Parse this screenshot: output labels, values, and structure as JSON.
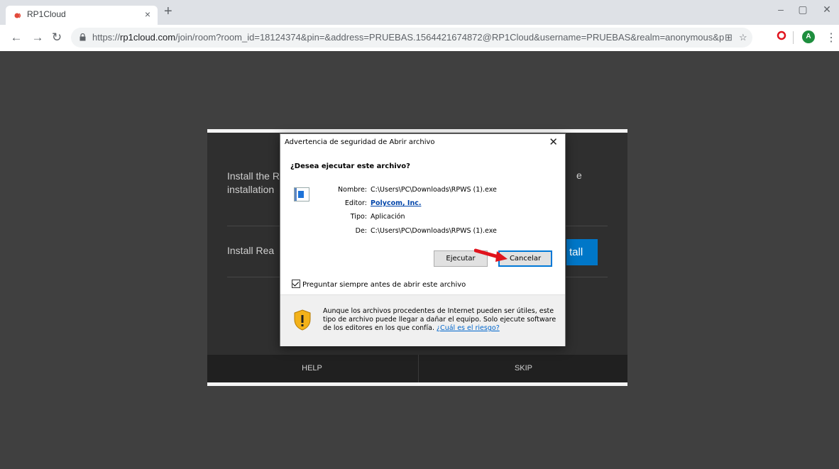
{
  "browser": {
    "tab_title": "RP1Cloud",
    "tab_close": "×",
    "new_tab": "+",
    "url_prefix": "https://",
    "url_host": "rp1cloud.com",
    "url_rest": "/join/room?room_id=18124374&pin=&address=PRUEBAS.1564421674872@RP1Cloud&username=PRUEBAS&realm=anonymous&path=mea&...",
    "profile_initial": "A",
    "window_controls": [
      "–",
      "▢",
      "✕"
    ]
  },
  "page": {
    "install_text_1": "Install the R                                                                                          e installation",
    "install_text_2": "Install Rea",
    "install_button": "tall",
    "help": "HELP",
    "skip": "SKIP"
  },
  "dialog": {
    "title": "Advertencia de seguridad de Abrir archivo",
    "question": "¿Desea ejecutar este archivo?",
    "name_label": "Nombre:",
    "name_value": "C:\\Users\\PC\\Downloads\\RPWS (1).exe",
    "publisher_label": "Editor:",
    "publisher_value": "Polycom, Inc.",
    "type_label": "Tipo:",
    "type_value": "Aplicación",
    "from_label": "De:",
    "from_value": "C:\\Users\\PC\\Downloads\\RPWS (1).exe",
    "run_button": "Ejecutar",
    "cancel_button": "Cancelar",
    "always_ask": "Preguntar siempre antes de abrir este archivo",
    "always_ask_checked": true,
    "warning_text": "Aunque los archivos procedentes de Internet pueden ser útiles, este tipo de archivo puede llegar a dañar el equipo. Solo ejecute software de los editores en los que confía.",
    "risk_link": "¿Cuál es el riesgo?"
  },
  "colors": {
    "accent": "#0077c8",
    "annotation_arrow": "#e0141e"
  }
}
